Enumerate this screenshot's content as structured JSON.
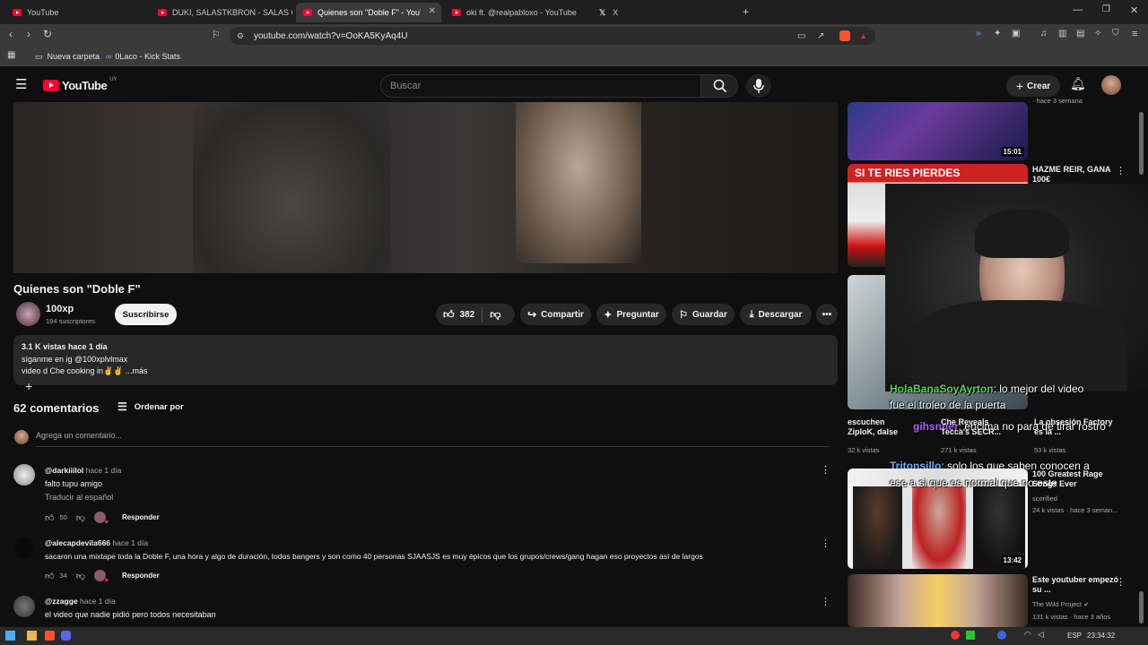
{
  "tabs": [
    {
      "label": "YouTube"
    },
    {
      "label": "DUKI, SALASTKBRON - SALAS CON E"
    },
    {
      "label": "Quienes son \"Doble F\" - YouTube"
    },
    {
      "label": "oki ft. @realpabloxo - YouTube"
    },
    {
      "label": "X"
    }
  ],
  "browser": {
    "url": "youtube.com/watch?v=OoKA5KyAq4U",
    "bookmarks": [
      "Nueva carpeta",
      "0Laco - Kick Stats"
    ]
  },
  "header": {
    "logo": "YouTube",
    "region": "UY",
    "search_placeholder": "Buscar",
    "create_label": "Crear"
  },
  "video": {
    "title": "Quienes son \"Doble F\"",
    "channel": "100xp",
    "subscribers": "194 suscriptores",
    "subscribe_label": "Suscribirse",
    "likes": "382",
    "share": "Compartir",
    "ask": "Preguntar",
    "save": "Guardar",
    "download": "Descargar"
  },
  "description": {
    "meta": "3.1 K vistas  hace 1 día",
    "line1": "síganme en ig @100xplvlmax",
    "line2": "video d Che cooking in✌️✌️ ...más"
  },
  "comments": {
    "count": "62 comentarios",
    "sort": "Ordenar por",
    "add_placeholder": "Agrega un comentario...",
    "items": [
      {
        "author": "@darkiiilol",
        "time": "hace 1 día",
        "text": "falto tupu amigo",
        "translate": "Traducir al español",
        "likes": "50",
        "reply": "Responder"
      },
      {
        "author": "@alecapdevila666",
        "time": "hace 1 día",
        "text": "sacaron una mixtape toda la Doble F, una hora y algo de duración, todos bangers y son como 40 personas SJAASJS es muy épicos que los grupos/crews/gang hagan eso proyectos así de largos",
        "likes": "34",
        "reply": "Responder"
      },
      {
        "author": "@zzagge",
        "time": "hace 1 día",
        "text": "el video que nadie pidió pero todos necesitaban"
      }
    ]
  },
  "sidebar": [
    {
      "duration": "15:01",
      "top_meta": "· hace 3 semana"
    },
    {
      "title": "HAZME REIR, GANA 100€",
      "thumb_text": "SI TE RIES PIERDES"
    },
    {
      "title_a": "escuchen ZiploK, dalse",
      "views_a": "32 k vistas",
      "title_b": "Che Reveals Tecca's SECR...",
      "views_b": "271 k vistas",
      "title_c": "La obsesión Factory es la ...",
      "views_c": "53 k vistas"
    },
    {
      "title": "100 Greatest Rage Songs Ever",
      "channel": "scorified",
      "meta": "24 k vistas · hace 3 seman...",
      "duration": "13:42"
    },
    {
      "title": "Este youtuber empezó su ...",
      "channel": "The Wild Project",
      "meta": "131 k vistas · hace 3 años"
    }
  ],
  "chat": [
    {
      "user": "HolaBanaSoyAyrton",
      "msg": ": lo mejor del video"
    },
    {
      "user": "",
      "msg": "fue el troleo de la puerta"
    },
    {
      "user": "gihsnner",
      "msg": ": encima no para de tirar rostro"
    },
    {
      "user": "Tritonsillo",
      "msg": ": solo los que saben conocen a"
    },
    {
      "user": "",
      "msg": "ese a si que es normal que no este"
    }
  ],
  "taskbar": {
    "lang": "ESP",
    "time": "23:34:32"
  }
}
